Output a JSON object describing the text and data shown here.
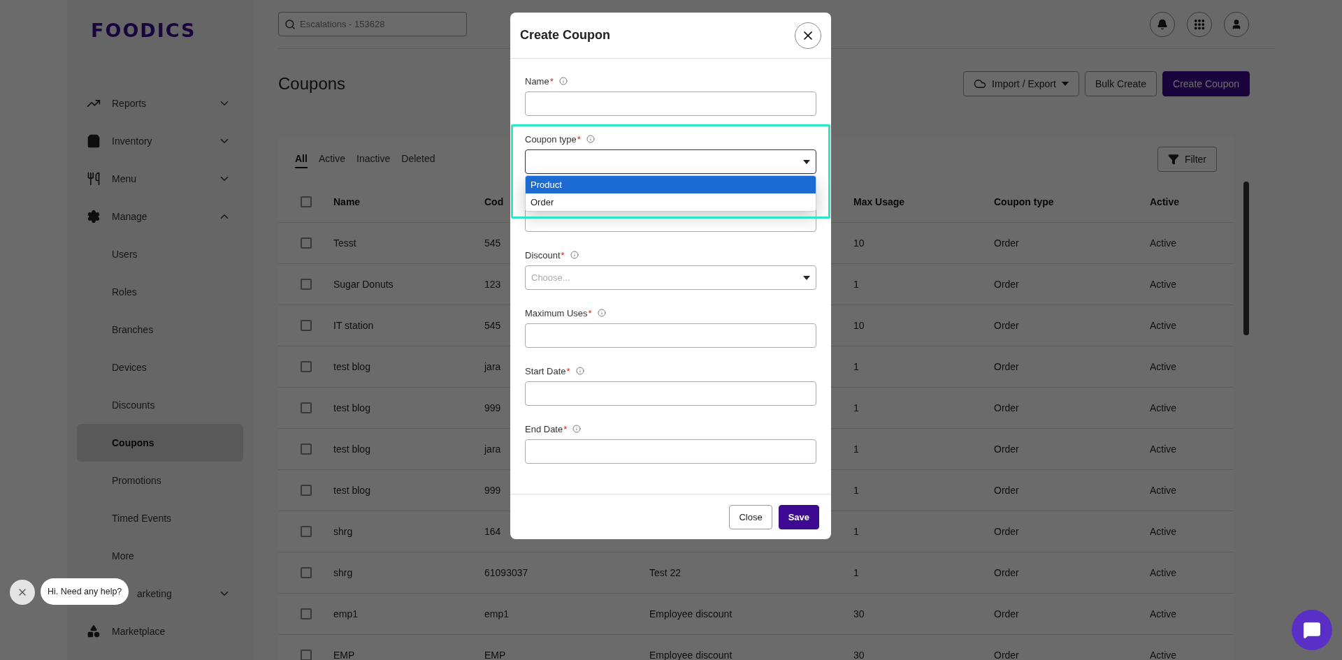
{
  "sidebar": {
    "logo": "FOODICS",
    "items": [
      {
        "label": "Reports",
        "expanded": false
      },
      {
        "label": "Inventory",
        "expanded": false
      },
      {
        "label": "Menu",
        "expanded": false
      },
      {
        "label": "Manage",
        "expanded": true,
        "children": [
          {
            "label": "Users",
            "selected": false
          },
          {
            "label": "Roles",
            "selected": false
          },
          {
            "label": "Branches",
            "selected": false
          },
          {
            "label": "Devices",
            "selected": false
          },
          {
            "label": "Discounts",
            "selected": false
          },
          {
            "label": "Coupons",
            "selected": true
          },
          {
            "label": "Promotions",
            "selected": false
          },
          {
            "label": "Timed Events",
            "selected": false
          },
          {
            "label": "More",
            "selected": false
          }
        ]
      },
      {
        "label": "arketing",
        "expanded": false,
        "clipped": true
      },
      {
        "label": "Marketplace"
      }
    ]
  },
  "search": {
    "placeholder": "Escalations - 153628"
  },
  "page": {
    "title": "Coupons"
  },
  "actions": [
    {
      "label": "Import / Export",
      "kind": "menu"
    },
    {
      "label": "Bulk Create",
      "kind": "secondary"
    },
    {
      "label": "Create Coupon",
      "kind": "primary"
    }
  ],
  "tabs": [
    {
      "label": "All",
      "selected": true
    },
    {
      "label": "Active",
      "selected": false
    },
    {
      "label": "Inactive",
      "selected": false
    },
    {
      "label": "Deleted",
      "selected": false
    }
  ],
  "filter": {
    "label": "Filter"
  },
  "table": {
    "all_checked": false,
    "columns": {
      "name": "Name",
      "code": "Cod",
      "max_usage": "Max Usage",
      "coupon_type": "Coupon type",
      "active": "Active"
    },
    "rows": [
      {
        "checked": false,
        "name": "Tesst",
        "code": "545",
        "max_usage": "10",
        "coupon_type": "Order",
        "active": "Active"
      },
      {
        "checked": false,
        "name": "Sugar Donuts",
        "code": "123",
        "max_usage": "1",
        "coupon_type": "Order",
        "active": "Active"
      },
      {
        "checked": false,
        "name": "IT station",
        "code": "545",
        "max_usage": "10",
        "coupon_type": "Order",
        "active": "Active"
      },
      {
        "checked": false,
        "name": "test blog",
        "code": "jara",
        "max_usage": "1",
        "coupon_type": "Order",
        "active": "Active"
      },
      {
        "checked": false,
        "name": "test blog",
        "code": "999",
        "max_usage": "1",
        "coupon_type": "Order",
        "active": "Active"
      },
      {
        "checked": false,
        "name": "test blog",
        "code": "jara",
        "max_usage": "1",
        "coupon_type": "Order",
        "active": "Active"
      },
      {
        "checked": false,
        "name": "test blog",
        "code": "999",
        "max_usage": "1",
        "coupon_type": "Order",
        "active": "Active"
      },
      {
        "checked": false,
        "name": "shrg",
        "code": "164",
        "max_usage": "1",
        "coupon_type": "Order",
        "active": "Active"
      },
      {
        "checked": false,
        "name": "shrg",
        "code": "61093037",
        "column_3": "Test 22",
        "max_usage": "1",
        "coupon_type": "Order",
        "active": "Active"
      },
      {
        "checked": false,
        "name": "emp1",
        "code": "emp1",
        "column_3": "Employee discount",
        "max_usage": "30",
        "coupon_type": "Order",
        "active": "Active"
      },
      {
        "checked": false,
        "name": "EMP",
        "code": "EMP",
        "column_3": "Employee discount",
        "max_usage": "30",
        "coupon_type": "Order",
        "active": "Active"
      }
    ]
  },
  "modal": {
    "title": "Create Coupon",
    "fields": [
      {
        "kind": "text",
        "label": "Name",
        "required_mark": "*"
      },
      {
        "kind": "select",
        "label": "Coupon type",
        "required_mark": "*",
        "open": true,
        "options": [
          {
            "label": "Product",
            "selected": true
          },
          {
            "label": "Order",
            "selected": false
          }
        ]
      },
      {
        "kind": "text"
      },
      {
        "kind": "select",
        "label": "Discount",
        "required_mark": "*",
        "placeholder": "Choose..."
      },
      {
        "kind": "text",
        "label": "Maximum Uses",
        "required_mark": "*"
      },
      {
        "kind": "text",
        "label": "Start Date",
        "required_mark": "*"
      },
      {
        "kind": "text",
        "label": "End Date",
        "required_mark": "*"
      }
    ],
    "buttons": [
      {
        "label": "Close",
        "kind": "secondary"
      },
      {
        "label": "Save",
        "kind": "primary"
      }
    ]
  },
  "chat": {
    "prompt": "Hi. Need any help?"
  }
}
